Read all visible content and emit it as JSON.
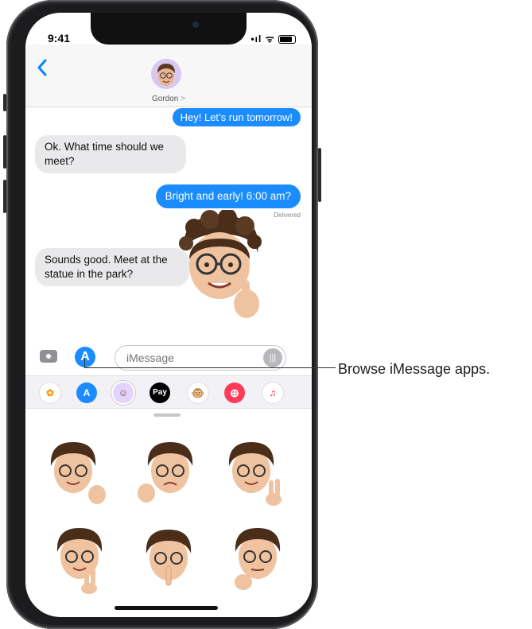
{
  "status_bar": {
    "time": "9:41",
    "signal": "•ıl",
    "wifi": "ᯤ"
  },
  "header": {
    "back_icon": "chevron-left-icon",
    "contact_name": "Gordon",
    "contact_chevron": ">"
  },
  "messages": [
    {
      "sender": "me",
      "text": "Hey! Let’s run tomorrow!"
    },
    {
      "sender": "them",
      "text": "Ok. What time should we meet?"
    },
    {
      "sender": "me",
      "text": "Bright and early! 6:00 am?"
    },
    {
      "sender": "them",
      "text": "Sounds good. Meet at the statue in the park?"
    }
  ],
  "delivered_label": "Delivered",
  "input": {
    "placeholder": "iMessage",
    "camera_icon": "camera-icon",
    "apps_icon": "app-store-icon",
    "audio_icon": "waveform-icon"
  },
  "app_drawer": [
    {
      "name": "photos",
      "icon": "photos-icon",
      "glyph": "✿",
      "bg": "#ffffff",
      "fg": "#ff9500"
    },
    {
      "name": "app-store",
      "icon": "app-store-icon",
      "glyph": "A",
      "bg": "#1a8cff",
      "fg": "#ffffff"
    },
    {
      "name": "memoji",
      "icon": "memoji-icon",
      "glyph": "☺",
      "bg": "#e3d3ff",
      "fg": "#6b4226"
    },
    {
      "name": "apple-pay",
      "icon": "apple-pay-icon",
      "glyph": "Pay",
      "bg": "#000000",
      "fg": "#ffffff"
    },
    {
      "name": "animoji",
      "icon": "monkey-icon",
      "glyph": "🐵",
      "bg": "#ffffff",
      "fg": "#8b5a2b"
    },
    {
      "name": "images-search",
      "icon": "search-globe-icon",
      "glyph": "⊕",
      "bg": "#ff3b5c",
      "fg": "#ffffff"
    },
    {
      "name": "music",
      "icon": "music-icon",
      "glyph": "♫",
      "bg": "#ffffff",
      "fg": "#ff2d55"
    }
  ],
  "callout": "Browse iMessage apps.",
  "colors": {
    "accent": "#1a8cff",
    "incoming": "#e9e9eb"
  }
}
